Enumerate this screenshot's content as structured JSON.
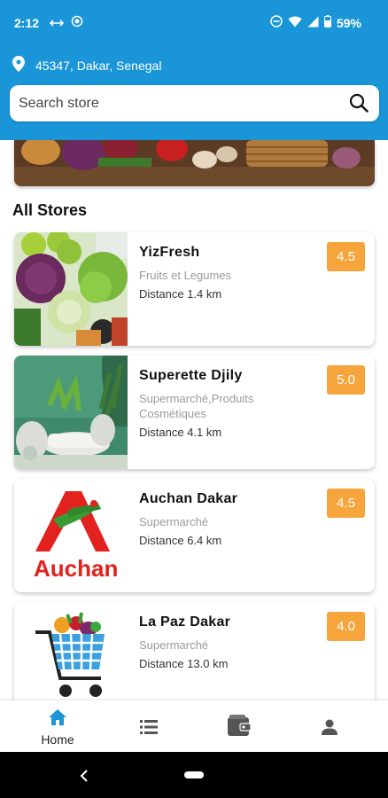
{
  "status_bar": {
    "time": "2:12",
    "battery": "59%"
  },
  "location": {
    "text": "45347, Dakar, Senegal",
    "icon": "location-pin-icon"
  },
  "search": {
    "placeholder": "Search store",
    "icon": "search-icon"
  },
  "section": {
    "title": "All Stores"
  },
  "stores": [
    {
      "name": "YizFresh",
      "category": "Fruits et Legumes",
      "distance": "Distance 1.4 km",
      "rating": "4.5",
      "image": "vegetables-image"
    },
    {
      "name": "Superette Djily",
      "category": "Supermarché,Produits Cosmétiques",
      "distance": "Distance 4.1 km",
      "rating": "5.0",
      "image": "cosmetics-image"
    },
    {
      "name": "Auchan Dakar",
      "category": "Supermarché",
      "distance": "Distance 6.4 km",
      "rating": "4.5",
      "image": "auchan-logo",
      "logo_text": "Auchan"
    },
    {
      "name": "La Paz Dakar",
      "category": "Supermarché",
      "distance": "Distance 13.0 km",
      "rating": "4.0",
      "image": "shopping-cart-image"
    }
  ],
  "bottom_nav": {
    "items": [
      {
        "label": "Home",
        "icon": "home-icon",
        "active": true
      },
      {
        "label": "",
        "icon": "list-icon"
      },
      {
        "label": "",
        "icon": "wallet-icon"
      },
      {
        "label": "",
        "icon": "profile-icon"
      }
    ]
  },
  "colors": {
    "header": "#1a96d8",
    "rating_badge": "#f6a53c",
    "active_nav": "#1a96d8",
    "inactive_nav": "#555555"
  }
}
